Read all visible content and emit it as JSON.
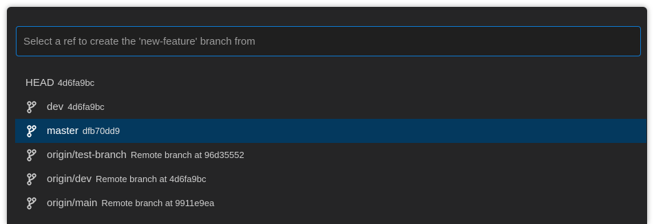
{
  "picker": {
    "placeholder": "Select a ref to create the 'new-feature' branch from",
    "value": ""
  },
  "items": [
    {
      "label": "HEAD",
      "description": "4d6fa9bc",
      "icon": null,
      "selected": false
    },
    {
      "label": "dev",
      "description": "4d6fa9bc",
      "icon": "git-branch-icon",
      "selected": false
    },
    {
      "label": "master",
      "description": "dfb70dd9",
      "icon": "git-branch-icon",
      "selected": true
    },
    {
      "label": "origin/test-branch",
      "description": "Remote branch at 96d35552",
      "icon": "git-branch-icon",
      "selected": false
    },
    {
      "label": "origin/dev",
      "description": "Remote branch at 4d6fa9bc",
      "icon": "git-branch-icon",
      "selected": false
    },
    {
      "label": "origin/main",
      "description": "Remote branch at 9911e9ea",
      "icon": "git-branch-icon",
      "selected": false
    }
  ],
  "colors": {
    "background": "#252526",
    "input_border": "#0e7ad3",
    "selection": "#04395e",
    "text": "#cccccc"
  }
}
